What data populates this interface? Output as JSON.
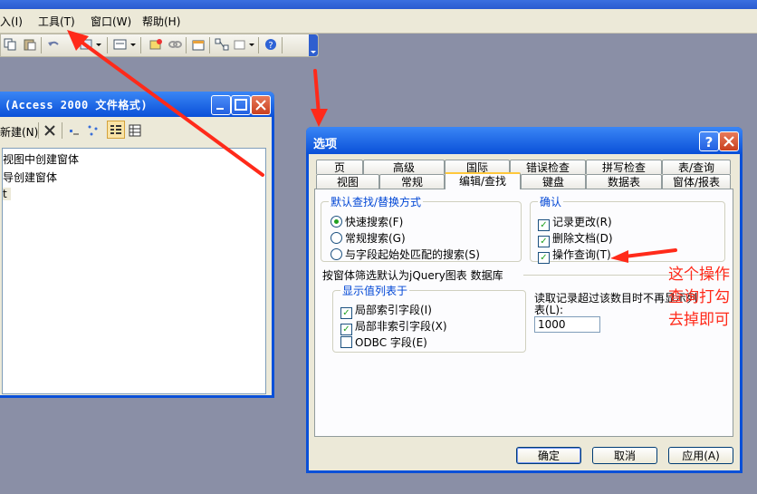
{
  "menubar": {
    "items": [
      {
        "label": "入(I)",
        "name": "menu-insert"
      },
      {
        "label": "工具(T)",
        "name": "menu-tools"
      },
      {
        "label": "窗口(W)",
        "name": "menu-window"
      },
      {
        "label": "帮助(H)",
        "name": "menu-help"
      }
    ]
  },
  "dbwindow": {
    "title": "(Access 2000 文件格式)",
    "new_label": "新建(N)",
    "items": [
      "视图中创建窗体",
      "导创建窗体",
      "t"
    ]
  },
  "dialog": {
    "title": "选项",
    "tabs_row1": [
      "页",
      "高级",
      "国际",
      "错误检查",
      "拼写检查",
      "表/查询"
    ],
    "tabs_row2": [
      "视图",
      "常规",
      "编辑/查找",
      "键盘",
      "数据表",
      "窗体/报表"
    ],
    "active_tab": "编辑/查找",
    "find_replace": {
      "title": "默认查找/替换方式",
      "options": [
        "快速搜索(F)",
        "常规搜索(G)",
        "与字段起始处匹配的搜索(S)"
      ],
      "selected": "快速搜索(F)"
    },
    "confirm": {
      "title": "确认",
      "options": [
        {
          "label": "记录更改(R)",
          "checked": true
        },
        {
          "label": "删除文档(D)",
          "checked": true
        },
        {
          "label": "操作查询(T)",
          "checked": true
        }
      ]
    },
    "filter_label": "按窗体筛选默认为jQuery图表 数据库",
    "show_list": {
      "title": "显示值列表于",
      "options": [
        {
          "label": "局部索引字段(I)",
          "checked": true
        },
        {
          "label": "局部非索引字段(X)",
          "checked": true
        },
        {
          "label": "ODBC 字段(E)",
          "checked": false
        }
      ]
    },
    "records_label_line1": "读取记录超过该数目时不再显示列",
    "records_label_line2": "表(L):",
    "records_value": "1000",
    "buttons": {
      "ok": "确定",
      "cancel": "取消",
      "apply": "应用(A)"
    }
  },
  "annotation": {
    "lines": [
      "这个操作",
      "查询打勾",
      "去掉即可"
    ],
    "color": "#ff2a1a"
  }
}
